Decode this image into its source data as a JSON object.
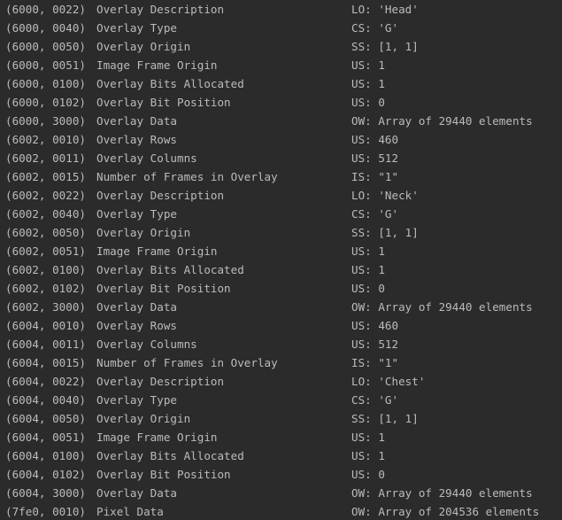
{
  "output": {
    "lines": [
      {
        "tag": "(6000, 0022)",
        "name": "Overlay Description",
        "value": "LO: 'Head'"
      },
      {
        "tag": "(6000, 0040)",
        "name": "Overlay Type",
        "value": "CS: 'G'"
      },
      {
        "tag": "(6000, 0050)",
        "name": "Overlay Origin",
        "value": "SS: [1, 1]"
      },
      {
        "tag": "(6000, 0051)",
        "name": "Image Frame Origin",
        "value": "US: 1"
      },
      {
        "tag": "(6000, 0100)",
        "name": "Overlay Bits Allocated",
        "value": "US: 1"
      },
      {
        "tag": "(6000, 0102)",
        "name": "Overlay Bit Position",
        "value": "US: 0"
      },
      {
        "tag": "(6000, 3000)",
        "name": "Overlay Data",
        "value": "OW: Array of 29440 elements"
      },
      {
        "tag": "(6002, 0010)",
        "name": "Overlay Rows",
        "value": "US: 460"
      },
      {
        "tag": "(6002, 0011)",
        "name": "Overlay Columns",
        "value": "US: 512"
      },
      {
        "tag": "(6002, 0015)",
        "name": "Number of Frames in Overlay",
        "value": "IS: \"1\""
      },
      {
        "tag": "(6002, 0022)",
        "name": "Overlay Description",
        "value": "LO: 'Neck'"
      },
      {
        "tag": "(6002, 0040)",
        "name": "Overlay Type",
        "value": "CS: 'G'"
      },
      {
        "tag": "(6002, 0050)",
        "name": "Overlay Origin",
        "value": "SS: [1, 1]"
      },
      {
        "tag": "(6002, 0051)",
        "name": "Image Frame Origin",
        "value": "US: 1"
      },
      {
        "tag": "(6002, 0100)",
        "name": "Overlay Bits Allocated",
        "value": "US: 1"
      },
      {
        "tag": "(6002, 0102)",
        "name": "Overlay Bit Position",
        "value": "US: 0"
      },
      {
        "tag": "(6002, 3000)",
        "name": "Overlay Data",
        "value": "OW: Array of 29440 elements"
      },
      {
        "tag": "(6004, 0010)",
        "name": "Overlay Rows",
        "value": "US: 460"
      },
      {
        "tag": "(6004, 0011)",
        "name": "Overlay Columns",
        "value": "US: 512"
      },
      {
        "tag": "(6004, 0015)",
        "name": "Number of Frames in Overlay",
        "value": "IS: \"1\""
      },
      {
        "tag": "(6004, 0022)",
        "name": "Overlay Description",
        "value": "LO: 'Chest'"
      },
      {
        "tag": "(6004, 0040)",
        "name": "Overlay Type",
        "value": "CS: 'G'"
      },
      {
        "tag": "(6004, 0050)",
        "name": "Overlay Origin",
        "value": "SS: [1, 1]"
      },
      {
        "tag": "(6004, 0051)",
        "name": "Image Frame Origin",
        "value": "US: 1"
      },
      {
        "tag": "(6004, 0100)",
        "name": "Overlay Bits Allocated",
        "value": "US: 1"
      },
      {
        "tag": "(6004, 0102)",
        "name": "Overlay Bit Position",
        "value": "US: 0"
      },
      {
        "tag": "(6004, 3000)",
        "name": "Overlay Data",
        "value": "OW: Array of 29440 elements"
      },
      {
        "tag": "(7fe0, 0010)",
        "name": "Pixel Data",
        "value": "OW: Array of 204536 elements"
      }
    ]
  }
}
